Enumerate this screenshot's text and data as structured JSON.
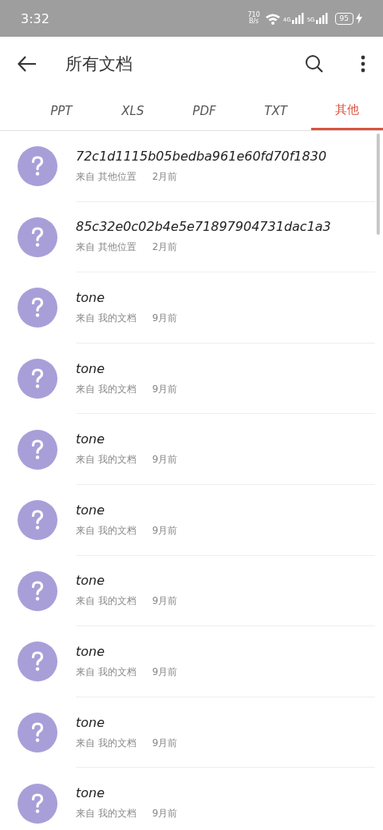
{
  "status_bar": {
    "time": "3:32",
    "net_speed": "710",
    "net_unit": "B/s",
    "signal_1": "4G",
    "signal_2": "5G",
    "battery": "95"
  },
  "header": {
    "title": "所有文档"
  },
  "tabs": [
    {
      "label": "PPT",
      "selected": false
    },
    {
      "label": "XLS",
      "selected": false
    },
    {
      "label": "PDF",
      "selected": false
    },
    {
      "label": "TXT",
      "selected": false
    },
    {
      "label": "其他",
      "selected": true
    }
  ],
  "files": [
    {
      "name": "72c1d1115b05bedba961e60fd70f1830",
      "source": "来自 其他位置",
      "time": "2月前"
    },
    {
      "name": "85c32e0c02b4e5e71897904731dac1a3",
      "source": "来自 其他位置",
      "time": "2月前"
    },
    {
      "name": "tone",
      "source": "来自 我的文档",
      "time": "9月前"
    },
    {
      "name": "tone",
      "source": "来自 我的文档",
      "time": "9月前"
    },
    {
      "name": "tone",
      "source": "来自 我的文档",
      "time": "9月前"
    },
    {
      "name": "tone",
      "source": "来自 我的文档",
      "time": "9月前"
    },
    {
      "name": "tone",
      "source": "来自 我的文档",
      "time": "9月前"
    },
    {
      "name": "tone",
      "source": "来自 我的文档",
      "time": "9月前"
    },
    {
      "name": "tone",
      "source": "来自 我的文档",
      "time": "9月前"
    },
    {
      "name": "tone",
      "source": "来自 我的文档",
      "time": "9月前"
    }
  ]
}
